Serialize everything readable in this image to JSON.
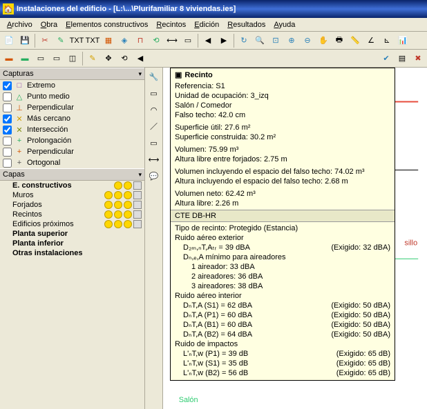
{
  "title": "Instalaciones del edificio - [L:\\...\\Plurifamiliar 8 viviendas.ies]",
  "menu": [
    "Archivo",
    "Obra",
    "Elementos constructivos",
    "Recintos",
    "Edición",
    "Resultados",
    "Ayuda"
  ],
  "sidebar": {
    "capturas_hdr": "Capturas",
    "snaps": [
      {
        "label": "Extremo",
        "checked": true,
        "color": "#8e44ad",
        "sym": "□"
      },
      {
        "label": "Punto medio",
        "checked": false,
        "color": "#27ae60",
        "sym": "△"
      },
      {
        "label": "Perpendicular",
        "checked": false,
        "color": "#d35400",
        "sym": "⊥"
      },
      {
        "label": "Más cercano",
        "checked": true,
        "color": "#d4a000",
        "sym": "✕"
      },
      {
        "label": "Intersección",
        "checked": true,
        "color": "#7f8c0d",
        "sym": "✕"
      },
      {
        "label": "Prolongación",
        "checked": false,
        "color": "#27ae60",
        "sym": "+"
      },
      {
        "label": "Perpendicular",
        "checked": false,
        "color": "#d35400",
        "sym": "+"
      },
      {
        "label": "Ortogonal",
        "checked": false,
        "color": "#555",
        "sym": "+"
      }
    ],
    "capas_hdr": "Capas",
    "layers": [
      {
        "name": "E. constructivos",
        "bold": true,
        "dots": 2
      },
      {
        "name": "Muros",
        "bold": false,
        "dots": 3
      },
      {
        "name": "Forjados",
        "bold": false,
        "dots": 3
      },
      {
        "name": "Recintos",
        "bold": false,
        "dots": 3
      },
      {
        "name": "Edificios próximos",
        "bold": false,
        "dots": 3
      },
      {
        "name": "Planta superior",
        "bold": true,
        "dots": 0
      },
      {
        "name": "Planta inferior",
        "bold": true,
        "dots": 0
      },
      {
        "name": "Otras instalaciones",
        "bold": true,
        "dots": 0
      }
    ]
  },
  "tooltip": {
    "title": "Recinto",
    "ref": "Referencia: S1",
    "unidad": "Unidad de ocupación: 3_izq",
    "tipo_hab": "Salón / Comedor",
    "falso_techo": "Falso techo: 42.0 cm",
    "sup_util": "Superficie útil: 27.6 m²",
    "sup_const": "Superficie construida: 30.2 m²",
    "vol": "Volumen: 75.99 m³",
    "alt_libre": "Altura libre entre forjados: 2.75 m",
    "vol_ft": "Volumen incluyendo el espacio del falso techo: 74.02 m³",
    "alt_ft": "Altura incluyendo el espacio del falso techo: 2.68 m",
    "vol_neto": "Volumen neto: 62.42 m³",
    "alt_libre2": "Altura libre: 2.26 m",
    "cte_hdr": "CTE DB-HR",
    "tipo_rec": "Tipo de recinto: Protegido (Estancia)",
    "ruido_ext_hdr": "Ruido aéreo exterior",
    "d2m": "D₂ₘ,ₙT,Aₜᵣ = 39 dBA",
    "d2m_req": "(Exigido: 32 dBA)",
    "aire_hdr": "Dₙ,ₑ,A mínimo para aireadores",
    "aire1": "1 aireador: 33 dBA",
    "aire2": "2 aireadores: 36 dBA",
    "aire3": "3 aireadores: 38 dBA",
    "ruido_int_hdr": "Ruido aéreo interior",
    "int1": "DₙT,A (S1) = 62 dBA",
    "int1r": "(Exigido: 50 dBA)",
    "int2": "DₙT,A (P1) = 60 dBA",
    "int2r": "(Exigido: 50 dBA)",
    "int3": "DₙT,A (B1) = 60 dBA",
    "int3r": "(Exigido: 50 dBA)",
    "int4": "DₙT,A (B2) = 64 dBA",
    "int4r": "(Exigido: 50 dBA)",
    "imp_hdr": "Ruido de impactos",
    "imp1": "L'ₙT,w (P1) = 39 dB",
    "imp1r": "(Exigido: 65 dB)",
    "imp2": "L'ₙT,w (S1) = 35 dB",
    "imp2r": "(Exigido: 65 dB)",
    "imp3": "L'ₙT,w (B2) = 56 dB",
    "imp3r": "(Exigido: 65 dB)"
  }
}
